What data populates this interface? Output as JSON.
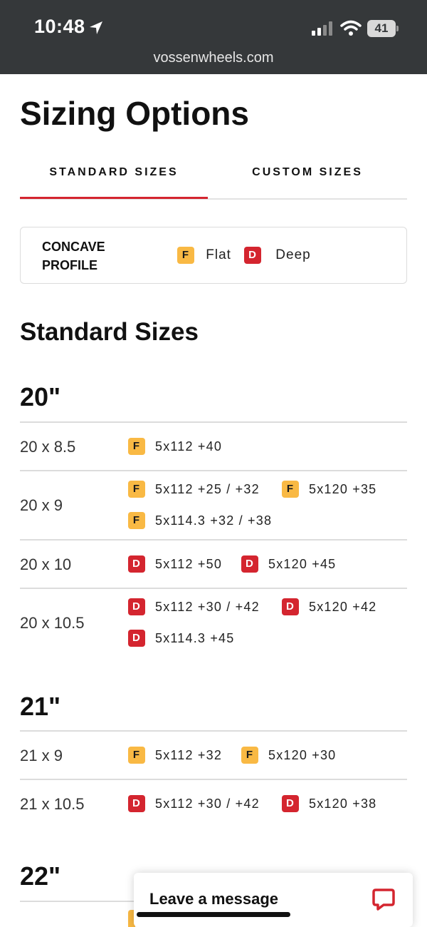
{
  "status_bar": {
    "time": "10:48",
    "battery": "41",
    "url": "vossenwheels.com"
  },
  "page": {
    "title": "Sizing Options"
  },
  "tabs": [
    {
      "label": "STANDARD SIZES",
      "active": true
    },
    {
      "label": "CUSTOM SIZES",
      "active": false
    }
  ],
  "legend": {
    "title": "CONCAVE PROFILE",
    "items": [
      {
        "badge": "F",
        "label": "Flat"
      },
      {
        "badge": "D",
        "label": "Deep"
      }
    ]
  },
  "section_title": "Standard Sizes",
  "groups": [
    {
      "diameter": "20\"",
      "rows": [
        {
          "size": "20 x 8.5",
          "specs": [
            {
              "badge": "F",
              "text": "5x112 +40"
            }
          ]
        },
        {
          "size": "20 x 9",
          "specs": [
            {
              "badge": "F",
              "text": "5x112 +25 / +32"
            },
            {
              "badge": "F",
              "text": "5x120 +35"
            },
            {
              "badge": "F",
              "text": "5x114.3 +32 / +38"
            }
          ]
        },
        {
          "size": "20 x 10",
          "specs": [
            {
              "badge": "D",
              "text": "5x112 +50"
            },
            {
              "badge": "D",
              "text": "5x120 +45"
            }
          ]
        },
        {
          "size": "20 x 10.5",
          "specs": [
            {
              "badge": "D",
              "text": "5x112 +30 / +42"
            },
            {
              "badge": "D",
              "text": "5x120 +42"
            },
            {
              "badge": "D",
              "text": "5x114.3 +45"
            }
          ]
        }
      ]
    },
    {
      "diameter": "21\"",
      "rows": [
        {
          "size": "21 x 9",
          "specs": [
            {
              "badge": "F",
              "text": "5x112 +32"
            },
            {
              "badge": "F",
              "text": "5x120 +30"
            }
          ]
        },
        {
          "size": "21 x 10.5",
          "specs": [
            {
              "badge": "D",
              "text": "5x112 +30 / +42"
            },
            {
              "badge": "D",
              "text": "5x120 +38"
            }
          ]
        }
      ]
    },
    {
      "diameter": "22\"",
      "rows": []
    }
  ],
  "chat": {
    "label": "Leave a message",
    "icon": "chat-bubble-icon"
  },
  "colors": {
    "flat_badge": "#f9b944",
    "deep_badge": "#d4252f",
    "accent": "#d4252f",
    "status_bar": "#35383a"
  }
}
